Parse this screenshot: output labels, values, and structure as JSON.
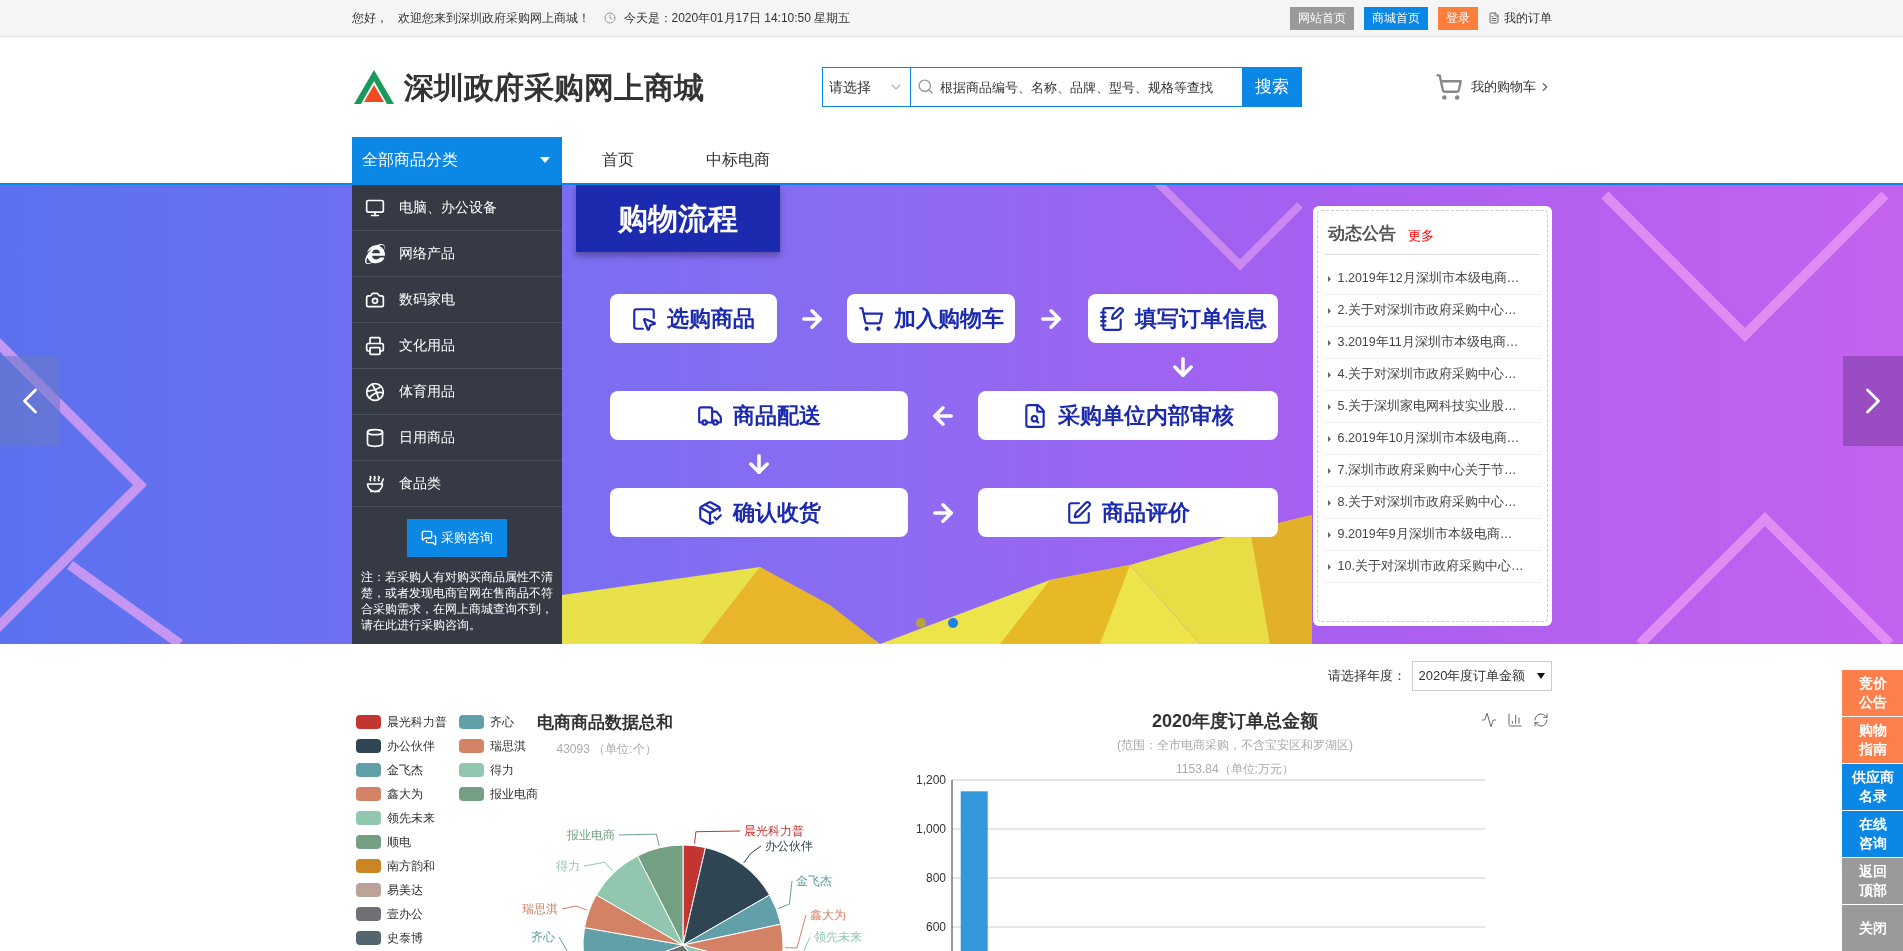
{
  "top_bar": {
    "greeting": "您好，",
    "welcome": "欢迎您来到深圳政府采购网上商城！",
    "datetime": "今天是：2020年01月17日 14:10:50 星期五",
    "buttons": [
      {
        "label": "网站首页",
        "color": "#9a9a9a"
      },
      {
        "label": "商城首页",
        "color": "#0b87e6"
      },
      {
        "label": "登录",
        "color": "#fc7d3c"
      }
    ],
    "orders_link": "我的订单"
  },
  "header": {
    "site_name": "深圳政府采购网上商城",
    "search": {
      "category": "请选择",
      "placeholder": "根据商品编号、名称、品牌、型号、规格等查找",
      "button": "搜索"
    },
    "cart": "我的购物车"
  },
  "nav": {
    "category_menu": "全部商品分类",
    "links": [
      "首页",
      "中标电商"
    ]
  },
  "sidebar": {
    "categories": [
      "电脑、办公设备",
      "网络产品",
      "数码家电",
      "文化用品",
      "体育用品",
      "日用商品",
      "食品类"
    ],
    "consult_button": "采购咨询",
    "note": "注：若采购人有对购买商品属性不清楚，或者发现电商官网在售商品不符合采购需求，在网上商城查询不到，请在此进行采购咨询。"
  },
  "banner": {
    "title": "购物流程",
    "steps": [
      "选购商品",
      "加入购物车",
      "填写订单信息",
      "商品配送",
      "采购单位内部审核",
      "确认收货",
      "商品评价"
    ],
    "dots": [
      {
        "selected": false
      },
      {
        "selected": true
      }
    ]
  },
  "announcements": {
    "title": "动态公告",
    "more": "更多",
    "items": [
      "1.2019年12月深圳市本级电商…",
      "2.关于对深圳市政府采购中心…",
      "3.2019年11月深圳市本级电商…",
      "4.关于对深圳市政府采购中心…",
      "5.关于深圳家电网科技实业股…",
      "6.2019年10月深圳市本级电商…",
      "7.深圳市政府采购中心关于节…",
      "8.关于对深圳市政府采购中心…",
      "9.2019年9月深圳市本级电商…",
      "10.关于对深圳市政府采购中心…"
    ]
  },
  "year_selector": {
    "label": "请选择年度：",
    "value": "2020年度订单金额"
  },
  "pie_section": {
    "title": "电商商品数据总和",
    "subtitle": "43093 （单位:个）",
    "legend": [
      {
        "name": "晨光科力普",
        "color": "#c23531"
      },
      {
        "name": "办公伙伴",
        "color": "#2f4554"
      },
      {
        "name": "金飞杰",
        "color": "#61a0a8"
      },
      {
        "name": "鑫大为",
        "color": "#d48265"
      },
      {
        "name": "领先未来",
        "color": "#91c7ae"
      },
      {
        "name": "顺电",
        "color": "#749f83"
      },
      {
        "name": "南方韵和",
        "color": "#ca8622"
      },
      {
        "name": "易美达",
        "color": "#bda29a"
      },
      {
        "name": "壹办公",
        "color": "#6e7074"
      },
      {
        "name": "史泰博",
        "color": "#546570"
      },
      {
        "name": "齐心",
        "color": "#61a0a8"
      },
      {
        "name": "瑞思淇",
        "color": "#d48265"
      },
      {
        "name": "得力",
        "color": "#91c7ae"
      },
      {
        "name": "报业电商",
        "color": "#749f83"
      }
    ],
    "slices": [
      {
        "label": "晨光科力普",
        "color": "#c23531"
      },
      {
        "label": "办公伙伴",
        "color": "#2f4554"
      },
      {
        "label": "金飞杰",
        "color": "#61a0a8"
      },
      {
        "label": "鑫大为",
        "color": "#d48265"
      },
      {
        "label": "领先未来",
        "color": "#91c7ae"
      },
      {
        "label": "齐心",
        "color": "#61a0a8"
      },
      {
        "label": "瑞思淇",
        "color": "#d48265"
      },
      {
        "label": "得力",
        "color": "#91c7ae"
      },
      {
        "label": "报业电商",
        "color": "#749f83"
      }
    ]
  },
  "bar_chart": {
    "title": "2020年度订单总金额",
    "subtitle": "(范围：全市电商采购，不含宝安区和罗湖区)",
    "unit_note": "1153.84（单位:万元）",
    "chart_data": {
      "type": "bar",
      "values": [
        1153.84
      ],
      "ylim": [
        0,
        1200
      ],
      "grid": true,
      "yticks": [
        {
          "value": 600,
          "label": "600"
        },
        {
          "value": 800,
          "label": "800"
        },
        {
          "value": 1000,
          "label": "1,000"
        },
        {
          "value": 1200,
          "label": "1,200"
        }
      ]
    }
  },
  "float_buttons": [
    {
      "lines": [
        "竞价",
        "公告"
      ],
      "color": "#fd7f4b"
    },
    {
      "lines": [
        "购物",
        "指南"
      ],
      "color": "#fd7f4b"
    },
    {
      "lines": [
        "供应商",
        "名录"
      ],
      "color": "#0b87e6"
    },
    {
      "lines": [
        "在线",
        "咨询"
      ],
      "color": "#0b87e6"
    },
    {
      "lines": [
        "返回",
        "顶部"
      ],
      "color": "#9a9a9a"
    },
    {
      "lines": [
        "关闭"
      ],
      "color": "#9a9a9a"
    }
  ]
}
